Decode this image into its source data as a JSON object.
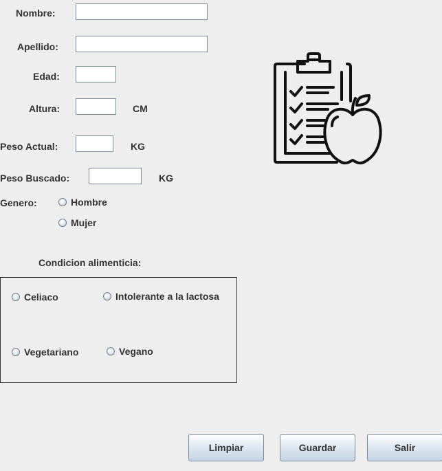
{
  "form": {
    "nombre_label": "Nombre:",
    "apellido_label": "Apellido:",
    "edad_label": "Edad:",
    "altura_label": "Altura:",
    "altura_unit": "CM",
    "peso_actual_label": "Peso Actual:",
    "peso_actual_unit": "KG",
    "peso_buscado_label": "Peso Buscado:",
    "peso_buscado_unit": "KG",
    "genero_label": "Genero:",
    "genero_options": [
      "Hombre",
      "Mujer"
    ],
    "nombre_value": "",
    "apellido_value": "",
    "edad_value": "",
    "altura_value": "",
    "peso_actual_value": "",
    "peso_buscado_value": ""
  },
  "condicion": {
    "title": "Condicion alimenticia:",
    "options": [
      "Celiaco",
      "Intolerante a la lactosa",
      "Vegetariano",
      "Vegano"
    ]
  },
  "buttons": {
    "limpiar": "Limpiar",
    "guardar": "Guardar",
    "salir": "Salir"
  },
  "icons": {
    "illustration": "clipboard-checklist-apple-icon",
    "radio": "radio-button-icon"
  }
}
